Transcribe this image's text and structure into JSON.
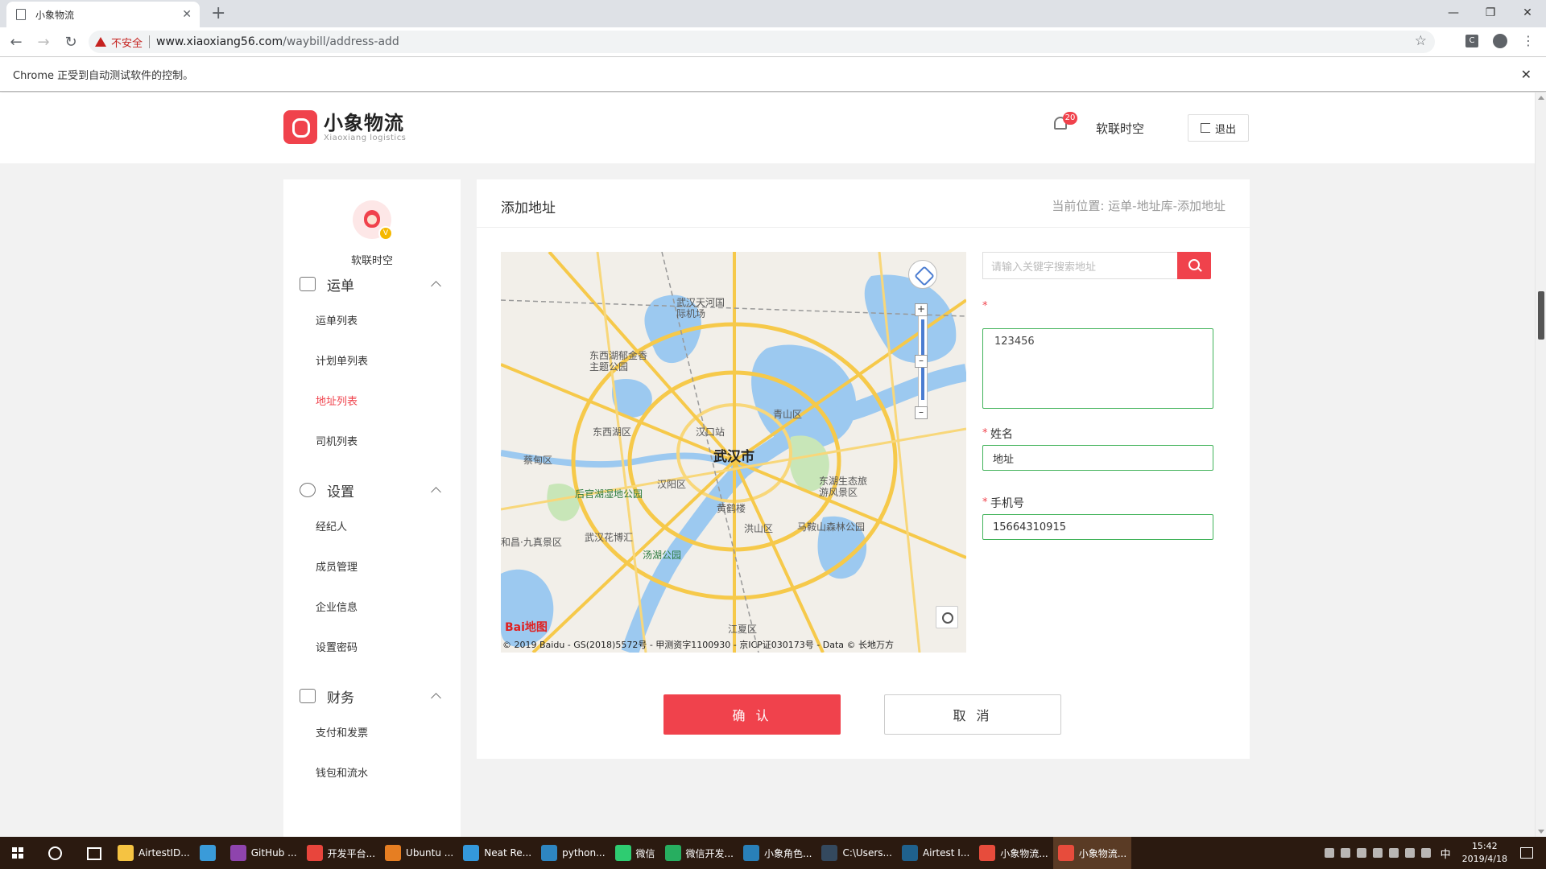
{
  "browser": {
    "tab_title": "小象物流",
    "insecure_label": "不安全",
    "url_host": "www.xiaoxiang56.com",
    "url_path": "/waybill/address-add",
    "infobar_text": "Chrome 正受到自动测试软件的控制。"
  },
  "header": {
    "brand_name": "小象物流",
    "brand_sub": "Xiaoxiang logistics",
    "notification_count": "20",
    "user_name": "软联时空",
    "logout_label": "退出"
  },
  "sidebar": {
    "user_name": "软联时空",
    "groups": [
      {
        "label": "运单",
        "icon": "truck-icon",
        "items": [
          "运单列表",
          "计划单列表",
          "地址列表",
          "司机列表"
        ]
      },
      {
        "label": "设置",
        "icon": "settings-icon",
        "items": [
          "经纪人",
          "成员管理",
          "企业信息",
          "设置密码"
        ]
      },
      {
        "label": "财务",
        "icon": "wallet-icon",
        "items": [
          "支付和发票",
          "钱包和流水"
        ]
      }
    ],
    "active_item": "地址列表"
  },
  "main": {
    "title": "添加地址",
    "breadcrumb": "当前位置: 运单-地址库-添加地址",
    "search_placeholder": "请输入关键字搜索地址",
    "address_value": "123456",
    "name_label": "姓名",
    "name_value": "地址",
    "phone_label": "手机号",
    "phone_value": "15664310915",
    "required_mark": "*",
    "confirm_label": "确 认",
    "cancel_label": "取 消"
  },
  "map": {
    "city_label": "武汉市",
    "copyright": "© 2019 Baidu - GS(2018)5572号 - 甲测资字1100930 - 京ICP证030173号 - Data © 长地万方",
    "logo_text": "Bai地图",
    "labels": {
      "airport": "武汉天河国际机场",
      "hankou_station": "汉口站",
      "park1": "东西湖郁金香主题公园",
      "park2": "后官湖湿地公园",
      "garden": "武汉花博汇",
      "tangxun_park": "汤湖公园",
      "huanghelou": "黄鹤楼",
      "east_lake": "东湖生态旅游风景区",
      "maanshan": "马鞍山森林公园",
      "qingshan": "青山区",
      "dongxihu": "东西湖区",
      "caidian": "蔡甸区",
      "hanyang": "汉阳区",
      "hongshan": "洪山区",
      "jiangxia": "江夏区",
      "jiuzhen": "和昌·九真景区"
    }
  },
  "taskbar": {
    "items": [
      {
        "label": "AirtestID...",
        "color": "#f5c342"
      },
      {
        "label": "",
        "color": "#3a9bd9"
      },
      {
        "label": "GitHub ...",
        "color": "#8e44ad"
      },
      {
        "label": "开发平台...",
        "color": "#e8453c"
      },
      {
        "label": "Ubuntu ...",
        "color": "#e67e22"
      },
      {
        "label": "Neat Re...",
        "color": "#3498db"
      },
      {
        "label": "python...",
        "color": "#2e86c1"
      },
      {
        "label": "微信",
        "color": "#2ecc71"
      },
      {
        "label": "微信开发...",
        "color": "#27ae60"
      },
      {
        "label": "小象角色...",
        "color": "#2980b9"
      },
      {
        "label": "C:\\Users...",
        "color": "#34495e"
      },
      {
        "label": "Airtest I...",
        "color": "#1f618d"
      },
      {
        "label": "小象物流...",
        "color": "#e74c3c"
      },
      {
        "label": "小象物流...",
        "color": "#e74c3c"
      }
    ],
    "ime": "中",
    "time": "15:42",
    "date": "2019/4/18"
  }
}
